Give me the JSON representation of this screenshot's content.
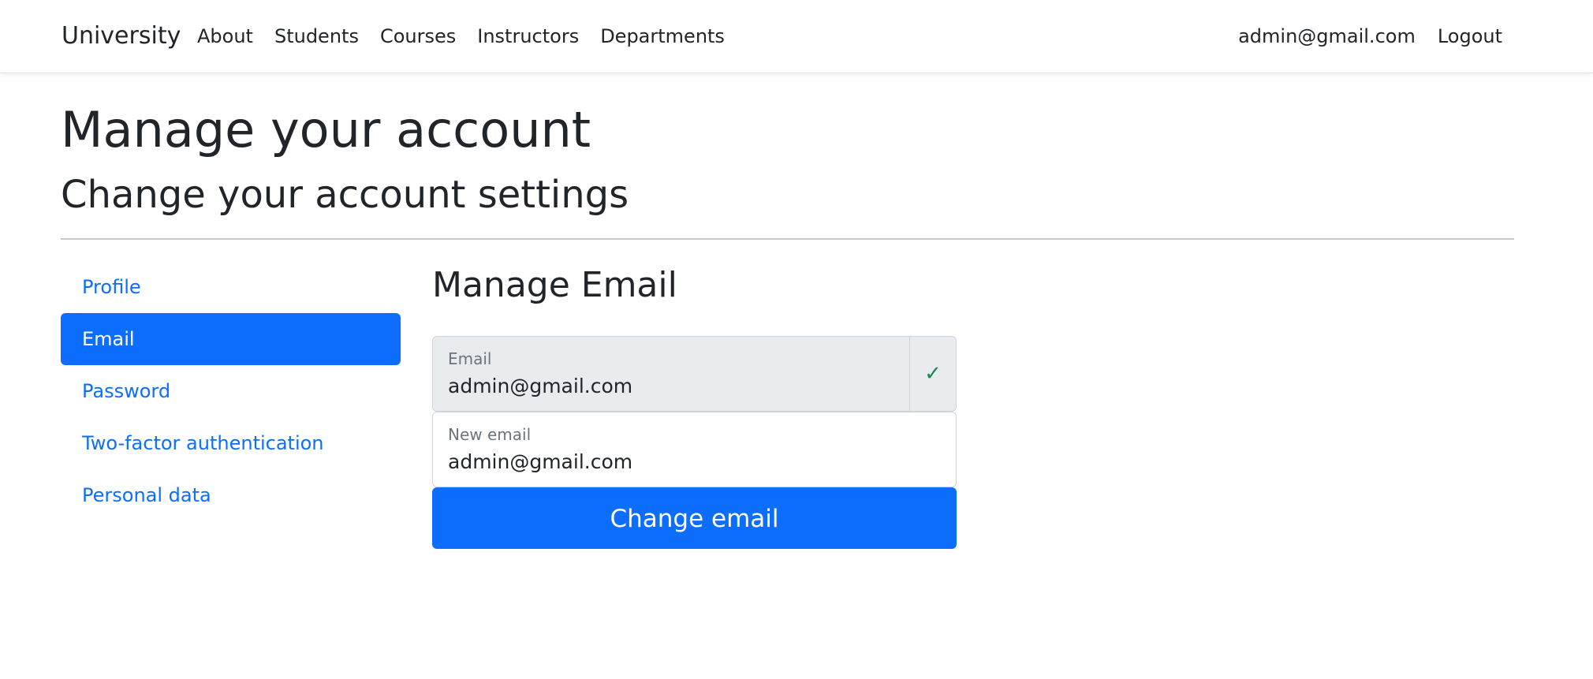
{
  "navbar": {
    "brand": "University",
    "links": [
      {
        "label": "About"
      },
      {
        "label": "Students"
      },
      {
        "label": "Courses"
      },
      {
        "label": "Instructors"
      },
      {
        "label": "Departments"
      }
    ],
    "user_email": "admin@gmail.com",
    "logout_label": "Logout"
  },
  "page": {
    "title": "Manage your account",
    "subtitle": "Change your account settings"
  },
  "sidebar": {
    "items": [
      {
        "label": "Profile",
        "active": false
      },
      {
        "label": "Email",
        "active": true
      },
      {
        "label": "Password",
        "active": false
      },
      {
        "label": "Two-factor authentication",
        "active": false
      },
      {
        "label": "Personal data",
        "active": false
      }
    ]
  },
  "main": {
    "section_title": "Manage Email",
    "email_field": {
      "label": "Email",
      "value": "admin@gmail.com",
      "confirmed_icon": "✓"
    },
    "new_email_field": {
      "label": "New email",
      "value": "admin@gmail.com"
    },
    "submit_label": "Change email"
  },
  "colors": {
    "primary": "#0d6efd",
    "success": "#198754",
    "disabled_bg": "#e9ecef"
  }
}
